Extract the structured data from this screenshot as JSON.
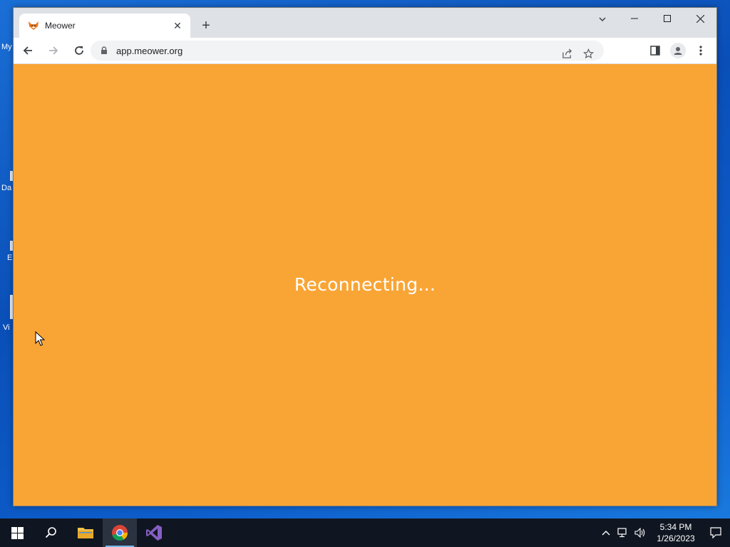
{
  "desktop": {
    "icons": [
      {
        "label": "My"
      },
      {
        "label": "Da"
      },
      {
        "label": "E"
      },
      {
        "label": "Vi"
      }
    ]
  },
  "browser": {
    "tab": {
      "title": "Meower",
      "favicon": "fox-icon"
    },
    "new_tab_label": "+",
    "url": "app.meower.org",
    "window_controls": {
      "minimize": "–",
      "maximize": "□",
      "close": "✕"
    }
  },
  "page": {
    "status_text": "Reconnecting...",
    "background_color": "#f9a535"
  },
  "taskbar": {
    "clock_time": "5:34 PM",
    "clock_date": "1/26/2023",
    "items": [
      "start",
      "search",
      "file-explorer",
      "chrome",
      "visual-studio"
    ]
  }
}
